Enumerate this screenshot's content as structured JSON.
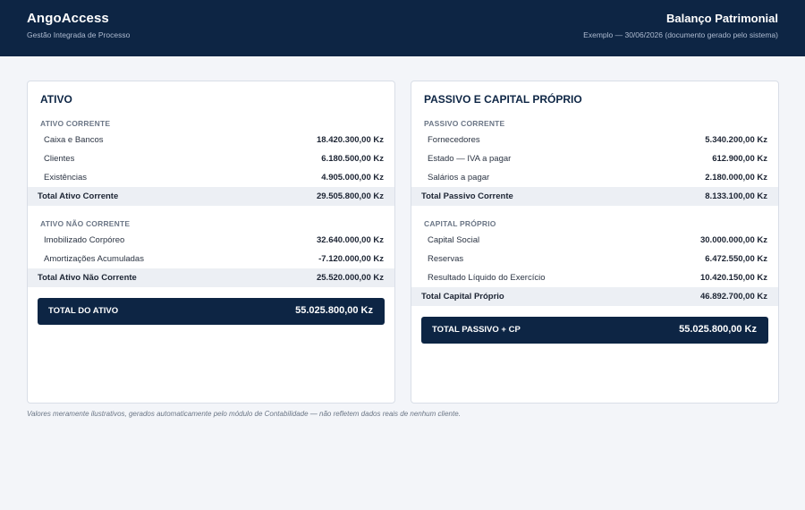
{
  "header": {
    "brand": "AngoAccess",
    "brand_subtitle": "Gestão Integrada de Processo",
    "doc_title": "Balanço Patrimonial",
    "doc_subtitle": "Exemplo — 30/06/2026 (documento gerado pelo sistema)"
  },
  "ativo": {
    "title": "ATIVO",
    "corrente": {
      "heading": "ATIVO CORRENTE",
      "items": [
        {
          "label": "Caixa e Bancos",
          "value": "18.420.300,00 Kz"
        },
        {
          "label": "Clientes",
          "value": "6.180.500,00 Kz"
        },
        {
          "label": "Existências",
          "value": "4.905.000,00 Kz"
        }
      ],
      "total_label": "Total Ativo Corrente",
      "total_value": "29.505.800,00 Kz"
    },
    "nao_corrente": {
      "heading": "ATIVO NÃO CORRENTE",
      "items": [
        {
          "label": "Imobilizado Corpóreo",
          "value": "32.640.000,00 Kz"
        },
        {
          "label": "Amortizações Acumuladas",
          "value": "-7.120.000,00 Kz"
        }
      ],
      "total_label": "Total Ativo Não Corrente",
      "total_value": "25.520.000,00 Kz"
    },
    "grand_label": "TOTAL DO ATIVO",
    "grand_value": "55.025.800,00 Kz"
  },
  "passivo": {
    "title": "PASSIVO E CAPITAL PRÓPRIO",
    "corrente": {
      "heading": "PASSIVO CORRENTE",
      "items": [
        {
          "label": "Fornecedores",
          "value": "5.340.200,00 Kz"
        },
        {
          "label": "Estado — IVA a pagar",
          "value": "612.900,00 Kz"
        },
        {
          "label": "Salários a pagar",
          "value": "2.180.000,00 Kz"
        }
      ],
      "total_label": "Total Passivo Corrente",
      "total_value": "8.133.100,00 Kz"
    },
    "capital": {
      "heading": "CAPITAL PRÓPRIO",
      "items": [
        {
          "label": "Capital Social",
          "value": "30.000.000,00 Kz"
        },
        {
          "label": "Reservas",
          "value": "6.472.550,00 Kz"
        },
        {
          "label": "Resultado Líquido do Exercício",
          "value": "10.420.150,00 Kz"
        }
      ],
      "total_label": "Total Capital Próprio",
      "total_value": "46.892.700,00 Kz"
    },
    "grand_label": "TOTAL PASSIVO + CP",
    "grand_value": "55.025.800,00 Kz"
  },
  "footnote": "Valores meramente ilustrativos, gerados automaticamente pelo módulo de Contabilidade — não refletem dados reais de nenhum cliente."
}
